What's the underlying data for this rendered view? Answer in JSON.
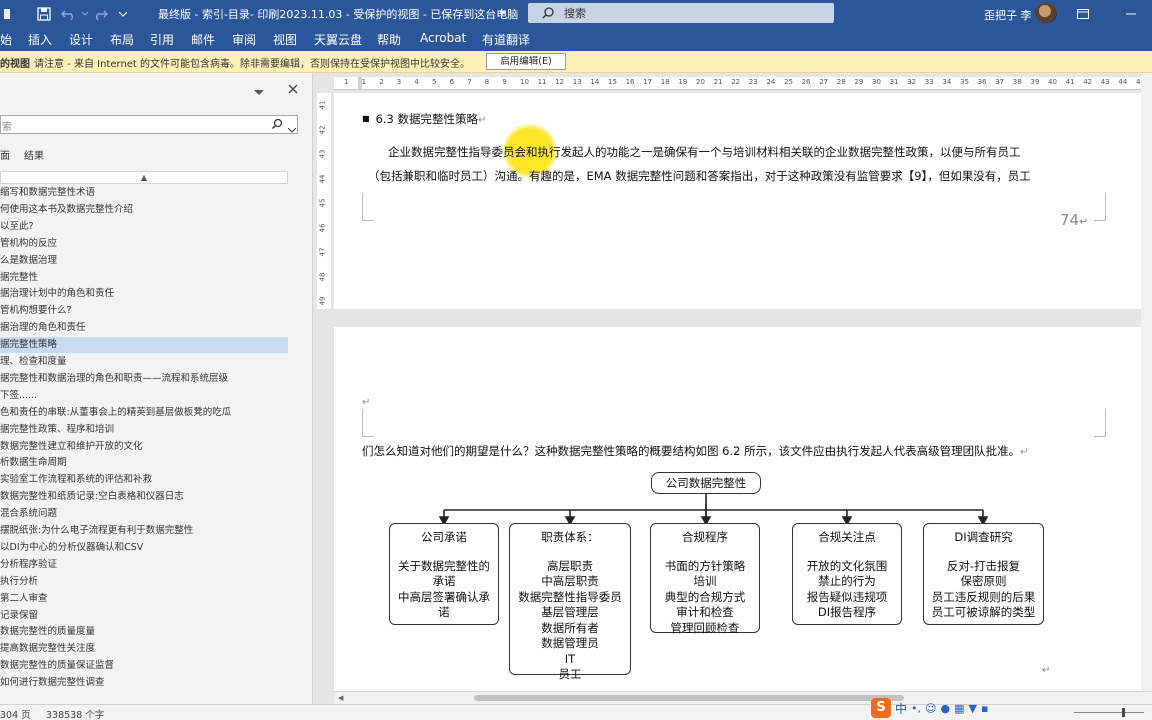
{
  "titlebar": {
    "title": "最终版 - 索引-目录- 印刷2023.11.03 - 受保护的视图 - 已保存到这台电脑",
    "search_placeholder": "搜索",
    "user_name": "歪把子 李"
  },
  "ribbon": {
    "tabs": [
      "始",
      "插入",
      "设计",
      "布局",
      "引用",
      "邮件",
      "审阅",
      "视图",
      "天翼云盘",
      "帮助",
      "Acrobat",
      "有道翻译"
    ]
  },
  "protected_view": {
    "label": "的视图",
    "message": "请注意 - 来自 Internet 的文件可能包含病毒。除非需要编辑，否则保持在受保护视图中比较安全。",
    "enable_button": "启用编辑(E)"
  },
  "nav_pane": {
    "search_placeholder": "索",
    "tab_pages": "面",
    "tab_results": "结果",
    "up_arrow": "▲",
    "items": [
      "缩写和数据完整性术语",
      "何使用这本书及数据完整性介绍",
      "以至此?",
      "管机构的反应",
      "么是数据治理",
      "据完整性",
      "据治理计划中的角色和责任",
      "管机构想要什么?",
      "据治理的角色和责任",
      "据完整性策略",
      "理、检查和度量",
      "据完整性和数据治理的角色和职责——流程和系统层级",
      "下签......",
      "色和责任的串联:从董事会上的精英到基层做板凳的吃瓜",
      "据完整性政策、程序和培训",
      "数据完整性建立和维护开放的文化",
      "析数据生命周期",
      "实验室工作流程和系统的评估和补救",
      "数据完整性和纸质记录:空白表格和仪器日志",
      "混合系统问题",
      "摆脱纸张:为什么电子流程更有利于数据完整性",
      "以DI为中心的分析仪器确认和CSV",
      "分析程序验证",
      "执行分析",
      "第二人审查",
      "记录保留",
      "数据完整性的质量度量",
      "提高数据完整性关注度",
      "数据完整性的质量保证监督",
      "如何进行数据完整性调查"
    ],
    "selected_index": 9
  },
  "document": {
    "heading": "6.3 数据完整性策略",
    "para1_line1": "企业数据完整性指导委员会和执行发起人的功能之一是确保有一个与培训材料相关联的企业数据完整性政策，以便与所有员工",
    "para1_line2": "（包括兼职和临时员工）沟通。有趣的是，EMA 数据完整性问题和答案指出，对于这种政策没有监管要求【9】，但如果没有，员工",
    "page_number": "74",
    "para2": "们怎么知道对他们的期望是什么？这种数据完整性策略的概要结构如图 6.2 所示，该文件应由执行发起人代表高级管理团队批准。",
    "ruler_numbers": [
      "1",
      "1",
      "2",
      "3",
      "4",
      "5",
      "6",
      "7",
      "8",
      "9",
      "10",
      "11",
      "12",
      "13",
      "14",
      "15",
      "16",
      "17",
      "18",
      "19",
      "20",
      "21",
      "22",
      "23",
      "24",
      "25",
      "26",
      "27",
      "28",
      "29",
      "30",
      "31",
      "32",
      "33",
      "34",
      "35",
      "36",
      "37",
      "38",
      "39",
      "40",
      "41",
      "42",
      "43",
      "44",
      "45"
    ],
    "vruler_numbers": [
      "41",
      "42",
      "43",
      "44",
      "45",
      "46",
      "47",
      "48",
      "49"
    ]
  },
  "org_chart": {
    "root": "公司数据完整性",
    "boxes": [
      {
        "title": "公司承诺",
        "lines": [
          "关于数据完整性的",
          "承诺",
          "中高层签署确认承",
          "诺"
        ]
      },
      {
        "title": "职责体系：",
        "lines": [
          "高层职责",
          "中高层职责",
          "数据完整性指导委员",
          "基层管理层",
          "数据所有者",
          "数据管理员",
          "IT",
          "员工"
        ]
      },
      {
        "title": "合规程序",
        "lines": [
          "书面的方针策略",
          "培训",
          "典型的合规方式",
          "审计和检查",
          "管理回顾检查"
        ]
      },
      {
        "title": "合规关注点",
        "lines": [
          "开放的文化氛围",
          "禁止的行为",
          "报告疑似违规项",
          "DI报告程序"
        ]
      },
      {
        "title": "DI调查研究",
        "lines": [
          "反对-打击报复",
          "保密原则",
          "员工违反规则的后果",
          "员工可被谅解的类型"
        ]
      }
    ]
  },
  "statusbar": {
    "pages": "304 页",
    "words": "338538 个字"
  },
  "ime": {
    "label": "中"
  }
}
